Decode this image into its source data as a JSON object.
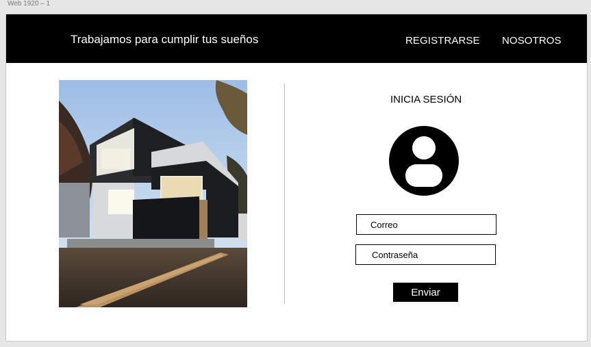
{
  "artboard": {
    "label": "Web 1920 – 1"
  },
  "header": {
    "tagline": "Trabajamos para cumplir tus sueños",
    "nav": {
      "register": "REGISTRARSE",
      "about": "NOSOTROS"
    }
  },
  "login": {
    "title": "INICIA SESIÓN",
    "email_placeholder": "Correo",
    "password_placeholder": "Contraseña",
    "submit_label": "Enviar"
  },
  "colors": {
    "header_bg": "#000000",
    "accent": "#000000",
    "page_bg": "#ffffff",
    "canvas_bg": "#e6e6e6"
  },
  "icons": {
    "avatar": "user-avatar-icon"
  }
}
